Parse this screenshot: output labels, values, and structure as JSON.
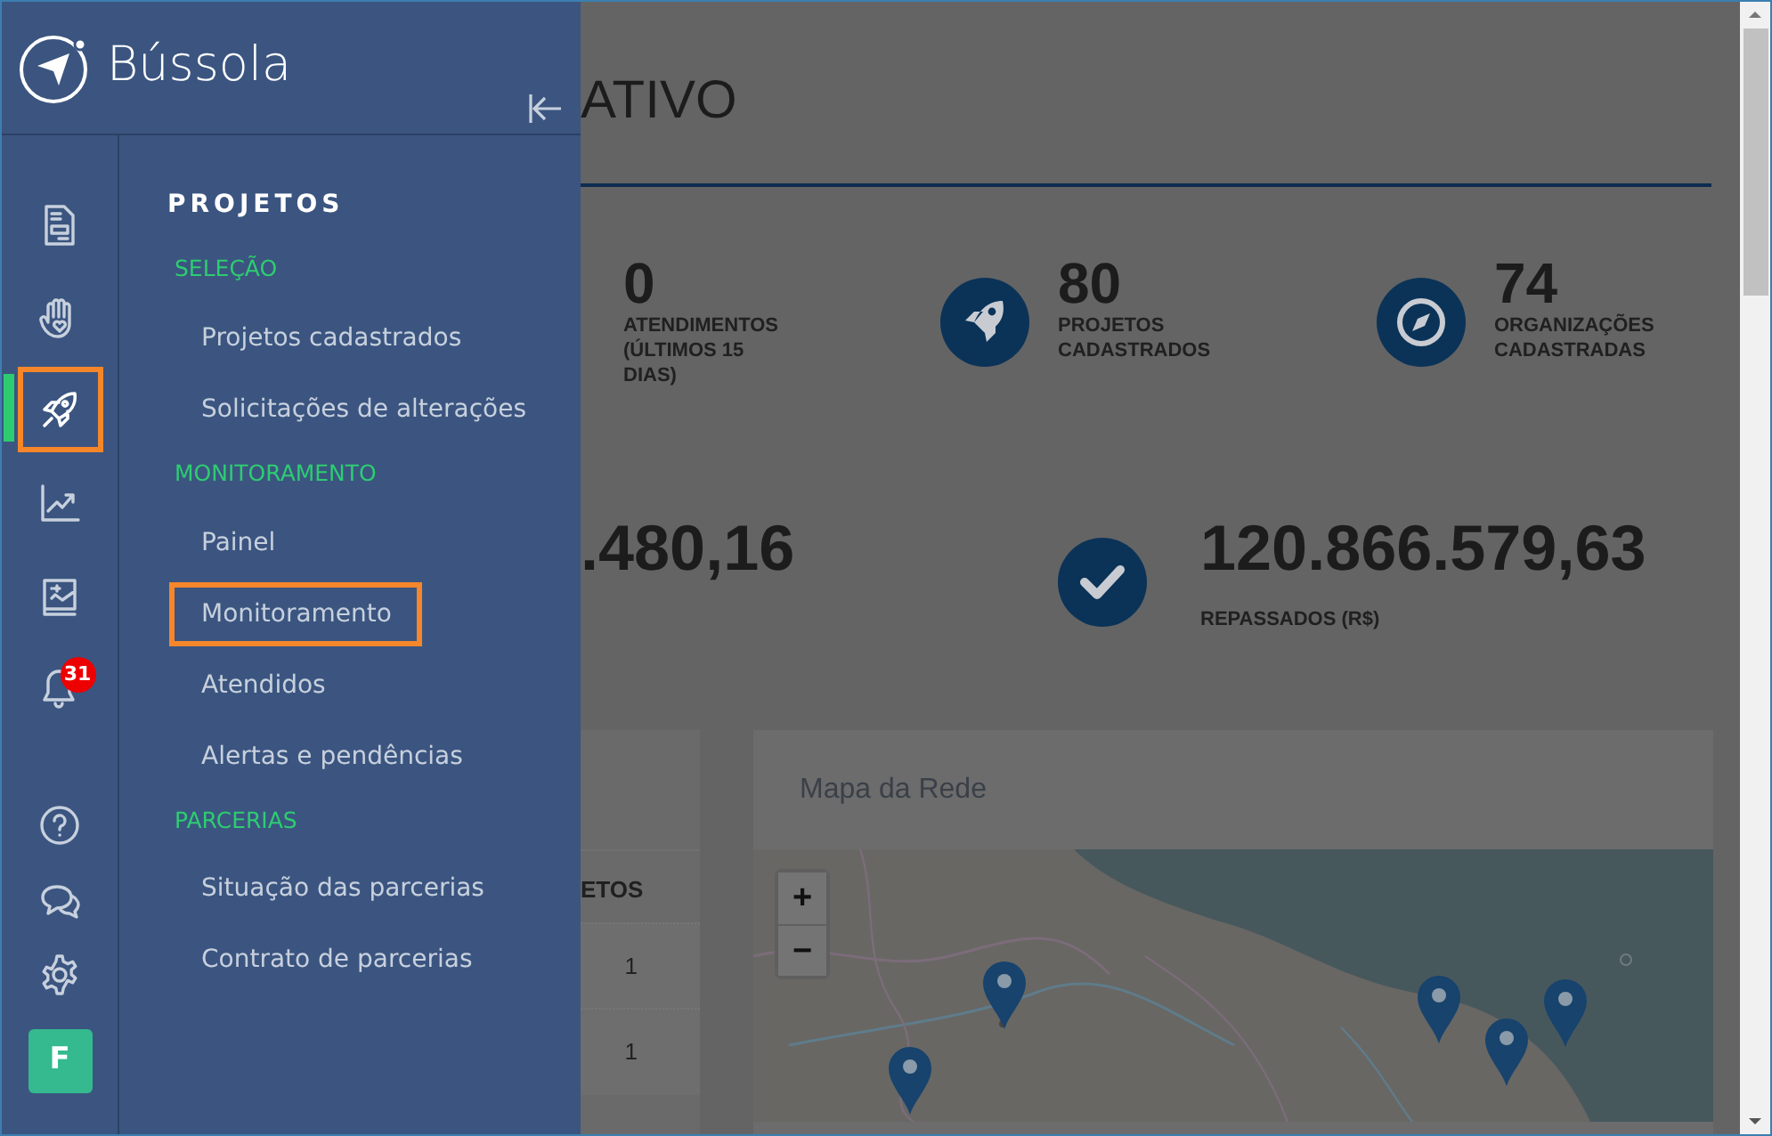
{
  "brand": {
    "name": "Bússola"
  },
  "rail": [
    {
      "kind": "document",
      "active": false,
      "highlighted": false
    },
    {
      "kind": "hand",
      "active": false,
      "highlighted": false
    },
    {
      "kind": "rocket",
      "active": true,
      "highlighted": true
    },
    {
      "kind": "chart",
      "active": false,
      "highlighted": false
    },
    {
      "kind": "book",
      "active": false,
      "highlighted": false
    },
    {
      "kind": "bell",
      "active": false,
      "highlighted": false,
      "badge": "31"
    }
  ],
  "rail_footer": [
    {
      "kind": "help"
    },
    {
      "kind": "chat"
    },
    {
      "kind": "settings"
    }
  ],
  "avatar": "F",
  "menu": {
    "title": "PROJETOS",
    "sections": [
      {
        "title": "SELEÇÃO",
        "items": [
          {
            "label": "Projetos cadastrados",
            "highlighted": false
          },
          {
            "label": "Solicitações de alterações",
            "highlighted": false
          }
        ]
      },
      {
        "title": "MONITORAMENTO",
        "items": [
          {
            "label": "Painel",
            "highlighted": false
          },
          {
            "label": "Monitoramento",
            "highlighted": true
          },
          {
            "label": "Atendidos",
            "highlighted": false
          },
          {
            "label": "Alertas e pendências",
            "highlighted": false
          }
        ]
      },
      {
        "title": "PARCERIAS",
        "items": [
          {
            "label": "Situação das parcerias",
            "highlighted": false
          },
          {
            "label": "Contrato de parcerias",
            "highlighted": false
          }
        ]
      }
    ]
  },
  "page": {
    "title": "ATIVO",
    "stats": [
      {
        "value": "0",
        "label": "ATENDIMENTOS (ÚLTIMOS 15 DIAS)"
      },
      {
        "kind": "rocket",
        "value": "80",
        "label": "PROJETOS CADASTRADOS"
      },
      {
        "kind": "compass",
        "value": "74",
        "label": "ORGANIZAÇÕES CADASTRADAS"
      }
    ],
    "totals": [
      {
        "value": ".480,16"
      },
      {
        "kind": "check",
        "value": "120.866.579,63",
        "label": "REPASSADOS (R$)"
      }
    ],
    "table": {
      "column": "ETOS",
      "cells": [
        "1",
        "1"
      ]
    },
    "map": {
      "title": "Mapa da Rede",
      "zoom": [
        "+",
        "−"
      ]
    }
  }
}
